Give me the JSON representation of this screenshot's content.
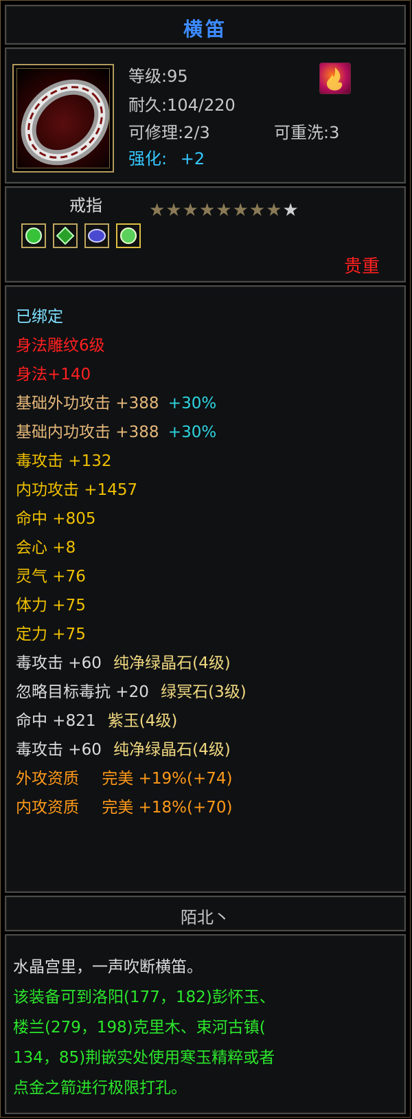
{
  "item": {
    "name": "横笛",
    "level": "等级:95",
    "durability": "耐久:104/220",
    "repair": "可修理:2/3",
    "rewash": "可重洗:3",
    "enhance_label": "强化:",
    "enhance_value": "+2",
    "type": "戒指",
    "rarity": "贵重",
    "stars": {
      "filled": 8,
      "total": 9
    },
    "gems": [
      "green-crystal",
      "green-crystal",
      "purple-jade",
      "green-crystal"
    ]
  },
  "stats": {
    "bound": "已绑定",
    "engrave": "身法雕纹6级",
    "agility": "身法+140",
    "base_ext": "基础外功攻击 +388",
    "base_ext_pct": "+30%",
    "base_int": "基础内功攻击 +388",
    "base_int_pct": "+30%",
    "poison_atk": "毒攻击 +132",
    "int_atk": "内功攻击 +1457",
    "hit": "命中 +805",
    "crit": "会心 +8",
    "spirit": "灵气 +76",
    "stamina": "体力 +75",
    "focus": "定力 +75",
    "gem1_stat": "毒攻击 +60",
    "gem1_name": "纯净绿晶石(4级)",
    "gem2_stat": "忽略目标毒抗 +20",
    "gem2_name": "绿冥石(3级)",
    "gem3_stat": "命中 +821",
    "gem3_name": "紫玉(4级)",
    "gem4_stat": "毒攻击 +60",
    "gem4_name": "纯净绿晶石(4级)",
    "apt_ext": "外攻资质",
    "apt_ext_val": "完美 +19%(+74)",
    "apt_int": "内攻资质",
    "apt_int_val": "完美 +18%(+70)"
  },
  "owner": "陌北丶",
  "description": {
    "flavor": "水晶宫里，一声吹断横笛。",
    "line1": "该装备可到洛阳(177，182)彭怀玉、",
    "line2": "楼兰(279，198)克里木、束河古镇(",
    "line3": "134，85)荆嵌实处使用寒玉精粹或者",
    "line4": "点金之箭进行极限打孔。"
  },
  "colors": {
    "title": "#3d8cff",
    "bound": "#7fe0ff",
    "red": "#ff2020",
    "tan": "#e6b87a",
    "accent": "#2ed4e0",
    "yellow": "#f0c000",
    "gold": "#ff9a1a",
    "green": "#2ce62c"
  }
}
